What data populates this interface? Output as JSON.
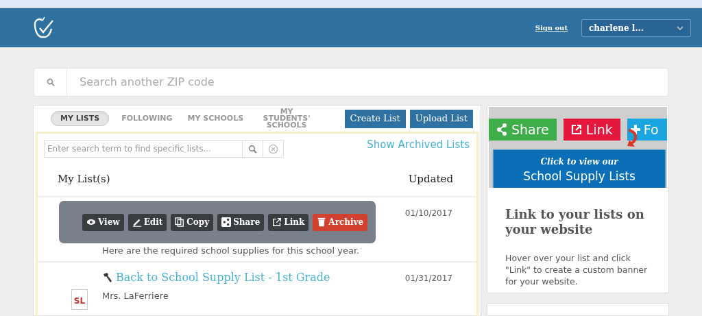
{
  "header": {
    "sign_out": "Sign out",
    "user_menu": "charlene l..."
  },
  "zip_search": {
    "placeholder": "Search another ZIP code"
  },
  "tabs": [
    {
      "label": "MY LISTS",
      "selected": true
    },
    {
      "label": "FOLLOWING",
      "selected": false
    },
    {
      "label": "MY SCHOOLS",
      "selected": false
    },
    {
      "label": "MY STUDENTS' SCHOOLS",
      "selected": false
    }
  ],
  "actions": [
    "Create List",
    "Upload List"
  ],
  "list_search": {
    "placeholder": "Enter search term to find specific lists..."
  },
  "show_archived": "Show Archived Lists",
  "columns": [
    "My List(s)",
    "Updated"
  ],
  "rows": [
    {
      "description": "Here are the required school supplies for this school year.",
      "updated": "01/10/2017",
      "hovered": true,
      "pinned": false
    },
    {
      "title": "Back to School Supply List - 1st Grade",
      "badge": "SL",
      "subtitle": "Mrs. LaFerriere",
      "updated": "01/31/2017",
      "hovered": false,
      "pinned": true
    }
  ],
  "row_actions": [
    {
      "kind": "view",
      "label": "View"
    },
    {
      "kind": "edit",
      "label": "Edit"
    },
    {
      "kind": "copy",
      "label": "Copy"
    },
    {
      "kind": "share",
      "label": "Share"
    },
    {
      "kind": "link",
      "label": "Link"
    },
    {
      "kind": "archive",
      "label": "Archive"
    }
  ],
  "promo": {
    "banner_buttons": [
      "Share",
      "Link",
      "Fo"
    ],
    "banner_line1": "Click to view our",
    "banner_line2": "School Supply Lists",
    "title": "Link to your lists on your website",
    "text": "Hover over your list and click \"Link\" to create a custom banner for your website."
  }
}
